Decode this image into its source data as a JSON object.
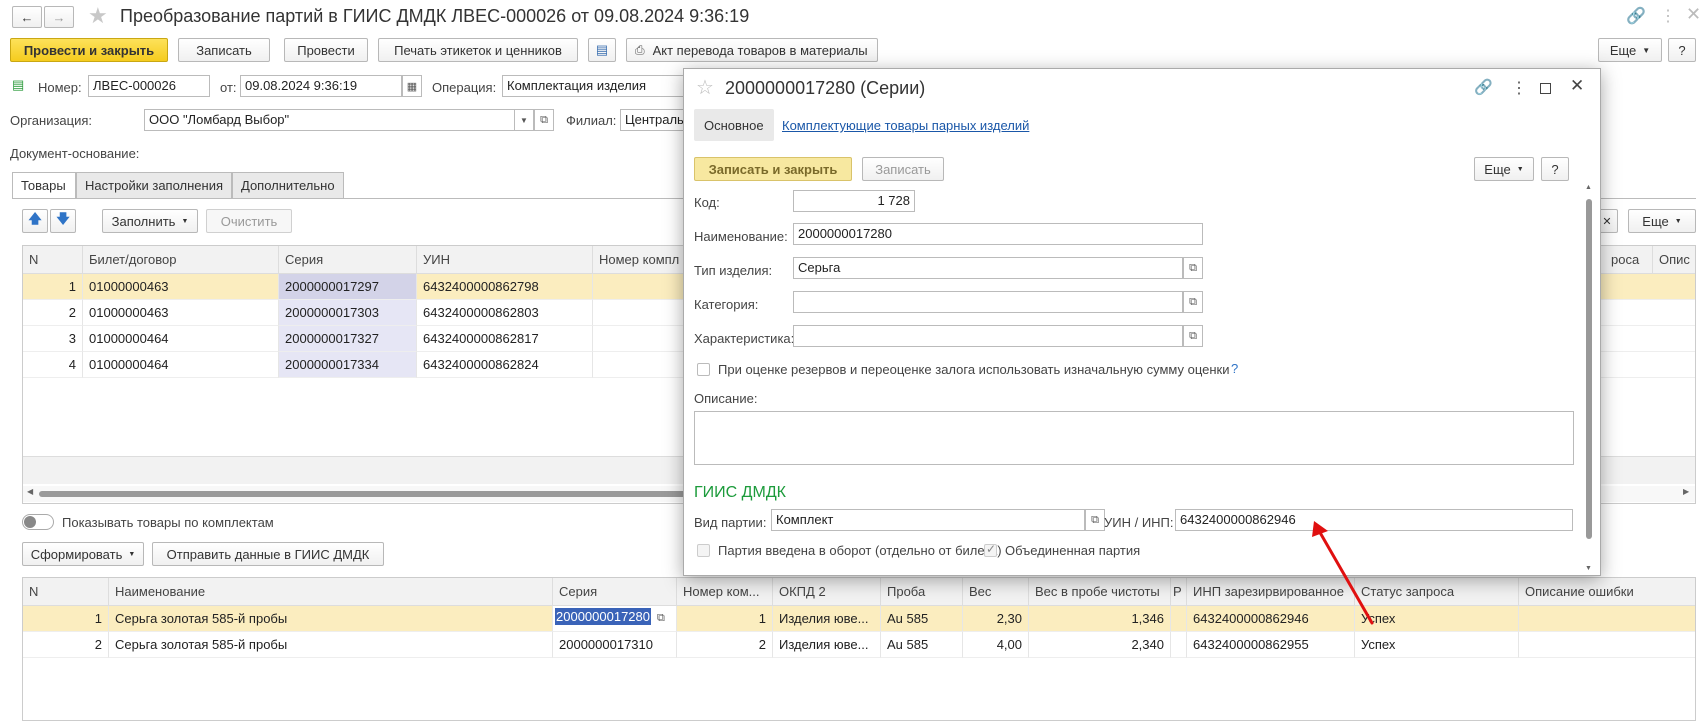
{
  "window": {
    "title": "Преобразование партий в ГИИС ДМДК ЛВЕС-000026 от 09.08.2024 9:36:19"
  },
  "toolbar": {
    "post_close": "Провести и закрыть",
    "save": "Записать",
    "post": "Провести",
    "print_labels": "Печать этикеток и ценников",
    "act_transfer": "Акт перевода товаров в материалы",
    "more": "Еще",
    "help": "?"
  },
  "header": {
    "number_label": "Номер:",
    "number_value": "ЛВЕС-000026",
    "date_label": "от:",
    "date_value": "09.08.2024  9:36:19",
    "operation_label": "Операция:",
    "operation_value": "Комплектация изделия",
    "org_label": "Организация:",
    "org_value": "ООО \"Ломбард Выбор\"",
    "branch_label": "Филиал:",
    "branch_value": "Централь",
    "basis_label": "Документ-основание:"
  },
  "tabs": [
    "Товары",
    "Настройки заполнения",
    "Дополнительно"
  ],
  "goods_toolbar": {
    "fill": "Заполнить",
    "clear": "Очистить",
    "more": "Еще"
  },
  "goods_table": {
    "columns": [
      "N",
      "Билет/договор",
      "Серия",
      "УИН",
      "Номер компл",
      "роса",
      "Опис"
    ],
    "rows": [
      {
        "n": "1",
        "ticket": "01000000463",
        "series": "2000000017297",
        "uin": "6432400000862798"
      },
      {
        "n": "2",
        "ticket": "01000000463",
        "series": "2000000017303",
        "uin": "6432400000862803"
      },
      {
        "n": "3",
        "ticket": "01000000464",
        "series": "2000000017327",
        "uin": "6432400000862817"
      },
      {
        "n": "4",
        "ticket": "01000000464",
        "series": "2000000017334",
        "uin": "6432400000862824"
      }
    ]
  },
  "lower": {
    "toggle_label": "Показывать товары по комплектам",
    "form_button": "Сформировать",
    "send_button": "Отправить данные в ГИИС ДМДК"
  },
  "lower_table": {
    "columns": [
      "N",
      "Наименование",
      "Серия",
      "Номер ком...",
      "ОКПД 2",
      "Проба",
      "Вес",
      "Вес в пробе чистоты",
      "Р",
      "ИНП зарезирвированное",
      "Статус запроса",
      "Описание ошибки"
    ],
    "rows": [
      {
        "n": "1",
        "name": "Серьга золотая 585-й пробы",
        "series": "2000000017280",
        "num": "1",
        "okpd": "Изделия юве...",
        "probe": "Au 585",
        "weight": "2,30",
        "pure": "1,346",
        "inp": "6432400000862946",
        "status": "Успех",
        "error": ""
      },
      {
        "n": "2",
        "name": "Серьга золотая 585-й пробы",
        "series": "2000000017310",
        "num": "2",
        "okpd": "Изделия юве...",
        "probe": "Au 585",
        "weight": "4,00",
        "pure": "2,340",
        "inp": "6432400000862955",
        "status": "Успех",
        "error": ""
      }
    ]
  },
  "modal": {
    "title": "2000000017280 (Серии)",
    "tab_main": "Основное",
    "tab_link": "Комплектующие товары парных изделий",
    "save_close": "Записать и закрыть",
    "save": "Записать",
    "more": "Еще",
    "help": "?",
    "code_label": "Код:",
    "code_value": "1 728",
    "name_label": "Наименование:",
    "name_value": "2000000017280",
    "type_label": "Тип изделия:",
    "type_value": "Серьга",
    "category_label": "Категория:",
    "category_value": "",
    "char_label": "Характеристика:",
    "char_value": "",
    "reserve_check_label": "При оценке резервов и переоценке залога использовать изначальную сумму оценки",
    "reserve_help": "?",
    "desc_label": "Описание:",
    "section_title": "ГИИС ДМДК",
    "batch_type_label": "Вид партии:",
    "batch_type_value": "Комплект",
    "uin_label": "УИН / ИНП:",
    "uin_value": "6432400000862946",
    "batch_circ_label": "Партия введена в оборот (отдельно от билета)",
    "batch_merged_label": "Объединенная партия"
  },
  "colors": {
    "accent_yellow": "#f5cc1e",
    "selected_row": "#fbedbf",
    "section_green": "#1c9b3b",
    "arrow_red": "#e01010"
  }
}
